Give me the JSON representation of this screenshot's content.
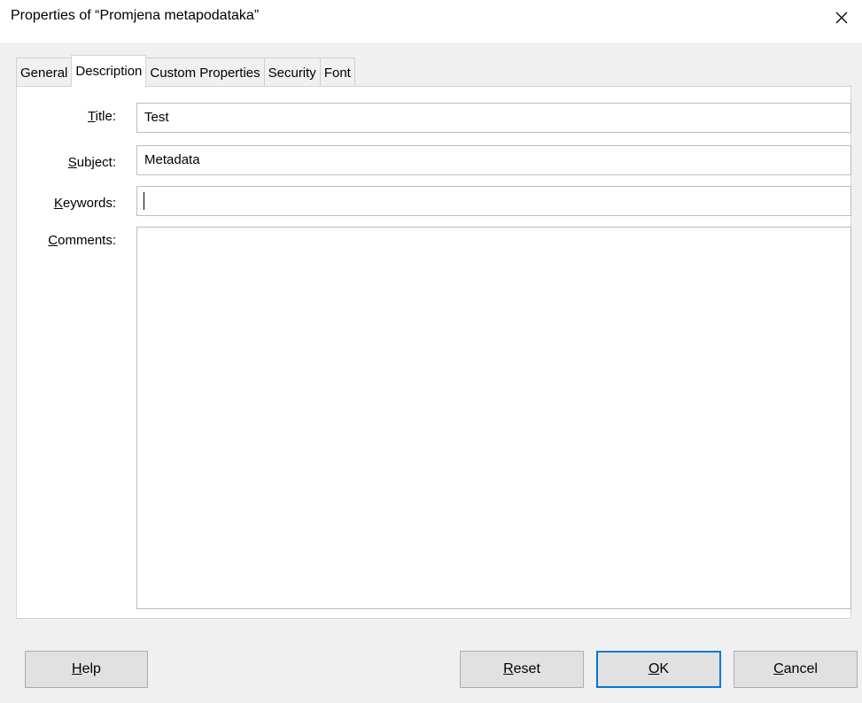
{
  "window": {
    "title": "Properties of “Promjena metapodataka”",
    "close_icon": "close-icon"
  },
  "tabs": [
    {
      "label": "General",
      "active": false
    },
    {
      "label": "Description",
      "active": true
    },
    {
      "label": "Custom Properties",
      "active": false
    },
    {
      "label": "Security",
      "active": false
    },
    {
      "label": "Font",
      "active": false
    }
  ],
  "form": {
    "title": {
      "label_accel": "T",
      "label_rest": "itle:",
      "value": "Test"
    },
    "subject": {
      "label_accel": "S",
      "label_rest": "ubject:",
      "value": "Metadata"
    },
    "keywords": {
      "label_accel": "K",
      "label_rest": "eywords:",
      "value": ""
    },
    "comments": {
      "label_accel": "C",
      "label_rest": "omments:",
      "value": ""
    }
  },
  "buttons": {
    "help": {
      "accel": "H",
      "rest": "elp"
    },
    "reset": {
      "accel": "R",
      "rest": "eset"
    },
    "ok": {
      "accel": "O",
      "rest": "K"
    },
    "cancel": {
      "accel": "C",
      "rest": "ancel"
    }
  },
  "colors": {
    "accent": "#0078d7",
    "dialog_bg": "#f0f0f0",
    "panel_bg": "#ffffff"
  }
}
